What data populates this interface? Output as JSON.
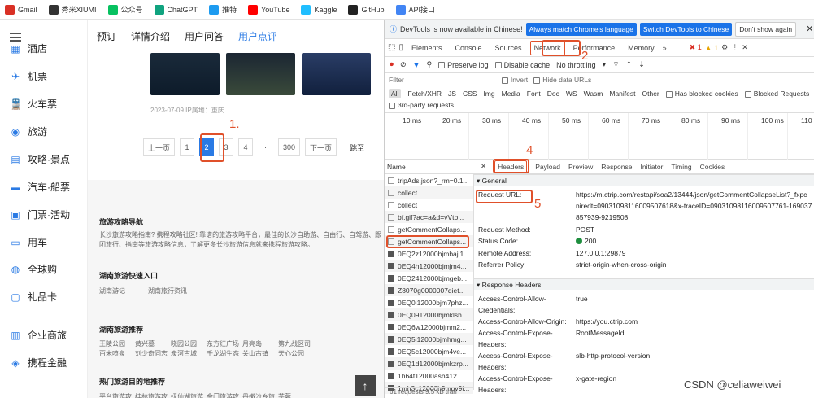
{
  "bookmarks": [
    {
      "label": "Gmail",
      "icon": "gmail-icon",
      "color": "#d93025"
    },
    {
      "label": "秀米XIUMI",
      "icon": "xiumi-icon",
      "color": "#333333"
    },
    {
      "label": "公众号",
      "icon": "wechat-icon",
      "color": "#07c160"
    },
    {
      "label": "ChatGPT",
      "icon": "chatgpt-icon",
      "color": "#10a37f"
    },
    {
      "label": "推特",
      "icon": "twitter-icon",
      "color": "#1d9bf0"
    },
    {
      "label": "YouTube",
      "icon": "youtube-icon",
      "color": "#ff0000"
    },
    {
      "label": "Kaggle",
      "icon": "kaggle-icon",
      "color": "#20beff"
    },
    {
      "label": "GitHub",
      "icon": "github-icon",
      "color": "#222222"
    },
    {
      "label": "API接口",
      "icon": "api-icon",
      "color": "#4285f4"
    }
  ],
  "sidebar": {
    "items": [
      "酒店",
      "机票",
      "火车票",
      "旅游",
      "攻略·景点",
      "汽车·船票",
      "门票·活动",
      "用车",
      "全球购",
      "礼品卡",
      "企业商旅",
      "携程金融"
    ]
  },
  "page": {
    "tabs": [
      "预订",
      "详情介绍",
      "用户问答",
      "用户点评"
    ],
    "meta": "2023-07-09  IP属地：重庆",
    "pager": {
      "prev": "上一页",
      "pages": [
        "1",
        "2",
        "3",
        "4",
        "···",
        "300"
      ],
      "next": "下一页",
      "jump": "跳至"
    },
    "guide_title": "旅游攻略导航",
    "guide_text": "长沙旅游攻略指南? 携程攻略社区! 靠谱的旅游攻略平台，最佳的长沙自助游、自由行、自驾游、跟团旅行、指南等旅游攻略信息，了解更多长沙旅游信息就来携程旅游攻略。",
    "quick_title": "湖南旅游快速入口",
    "quick": [
      "湖南游记",
      "湖南旅行资讯"
    ],
    "rec_title": "湖南旅游推荐",
    "rec_row1": [
      "王陵公园",
      "黄兴墓",
      "晓园公园",
      "东方红广场",
      "月亮岛",
      "第九战区司"
    ],
    "rec_row2": [
      "百米喷泉",
      "刘少奇同志",
      "炭河古城",
      "千龙湖生态",
      "关山古镇",
      "天心公园"
    ],
    "hot_title": "热门旅游目的地推荐",
    "hot_row1": [
      "平台旅游攻",
      "桂林旅游攻",
      "抚仙湖旅游",
      "金门旅游攻",
      "丹嫩沙乡旅",
      "芙蓉"
    ],
    "hot_row2": [
      "海港城旅游",
      "拉托维亚旅",
      "德钦旅游攻",
      "伦敦旅游攻",
      "上林旅游攻",
      "乌兰"
    ]
  },
  "annotations": [
    "1.",
    "2",
    "3",
    "4",
    "5"
  ],
  "devtools": {
    "banner": {
      "text": "DevTools is now available in Chinese!",
      "btn1": "Always match Chrome's language",
      "btn2": "Switch DevTools to Chinese",
      "btn3": "Don't show again"
    },
    "tabs": [
      "Elements",
      "Console",
      "Sources",
      "Network",
      "Performance",
      "Memory"
    ],
    "more": "»",
    "errors": "1",
    "warnings": "1",
    "toolbar": {
      "preserve": "Preserve log",
      "disable": "Disable cache",
      "throttle": "No throttling"
    },
    "filter": {
      "label": "Filter",
      "invert": "Invert",
      "hide": "Hide data URLs"
    },
    "types": [
      "All",
      "Fetch/XHR",
      "JS",
      "CSS",
      "Img",
      "Media",
      "Font",
      "Doc",
      "WS",
      "Wasm",
      "Manifest",
      "Other"
    ],
    "blocked_cookies": "Has blocked cookies",
    "blocked_req": "Blocked Requests",
    "third": "3rd-party requests",
    "ticks": [
      "10 ms",
      "20 ms",
      "30 ms",
      "40 ms",
      "50 ms",
      "60 ms",
      "70 ms",
      "80 ms",
      "90 ms",
      "100 ms",
      "110"
    ],
    "name_header": "Name",
    "requests": [
      "tripAds.json?_rm=0.1...",
      "collect",
      "collect",
      "bf.gif?ac=a&d=vVtb...",
      "getCommentCollaps...",
      "getCommentCollaps...",
      "0EQ2z12000bjmbaji1...",
      "0EQ4h12000bjmjm4...",
      "0EQ2412000bjmgeb...",
      "Z8070g0000007qiet...",
      "0EQ0i12000bjm7phz...",
      "0EQ0912000bjmklsh...",
      "0EQ6w12000bjmm2...",
      "0EQ5i12000bjmhmg...",
      "0EQ5c12000bjm4ve...",
      "0EQ1d12000bjmkzrp...",
      "1h64t12000ash412...",
      "1mh3c12000h9mqv9i..."
    ],
    "footer": "61 requests   9.5 kB tran",
    "detail_tabs": [
      "Headers",
      "Payload",
      "Preview",
      "Response",
      "Initiator",
      "Timing",
      "Cookies"
    ],
    "general": "▾ General",
    "general_rows": [
      {
        "k": "Request URL:",
        "v": "https://m.ctrip.com/restapi/soa2/13444/json/getCommentCollapseList?_fxpc",
        "v2": "niredt=09031098116009507618&x-traceID=09031098116009507761-169037",
        "v3": "857939-9219508"
      },
      {
        "k": "Request Method:",
        "v": "POST"
      },
      {
        "k": "Status Code:",
        "v": "200"
      },
      {
        "k": "Remote Address:",
        "v": "127.0.0.1:29879"
      },
      {
        "k": "Referrer Policy:",
        "v": "strict-origin-when-cross-origin"
      }
    ],
    "response": "▾ Response Headers",
    "resp_rows": [
      {
        "k": "Access-Control-Allow-",
        "k2": "Credentials:",
        "v": "true"
      },
      {
        "k": "Access-Control-Allow-Origin:",
        "v": "https://you.ctrip.com"
      },
      {
        "k": "Access-Control-Expose-",
        "k2": "Headers:",
        "v": "RootMessageId"
      },
      {
        "k": "Access-Control-Expose-",
        "k2": "Headers:",
        "v": "slb-http-protocol-version"
      },
      {
        "k": "Access-Control-Expose-",
        "k2": "Headers:",
        "v": "x-gate-region"
      }
    ]
  },
  "watermark": "CSDN @celiaweiwei"
}
